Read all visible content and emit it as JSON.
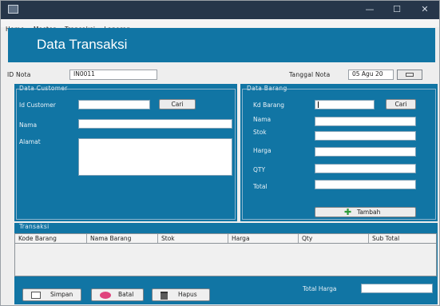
{
  "window": {
    "controls": {
      "minimize": "—",
      "maximize": "☐",
      "close": "✕"
    }
  },
  "menu": [
    "Home",
    "Master",
    "Transaksi",
    "Laporan"
  ],
  "header": {
    "title": "Data Transaksi"
  },
  "id_row": {
    "id_label": "ID Nota",
    "id_value": "IN0011",
    "date_label": "Tanggal Nota",
    "date_value": "05 Agu 20"
  },
  "customer": {
    "legend": "Data Customer",
    "id_label": "Id Customer",
    "search_label": "Cari",
    "name_label": "Nama",
    "address_label": "Alamat"
  },
  "barang": {
    "legend": "Data Barang",
    "kd_label": "Kd Barang",
    "search_label": "Cari",
    "name_label": "Nama",
    "stok_label": "Stok",
    "harga_label": "Harga",
    "qty_label": "QTY",
    "total_label": "Total",
    "add_label": "Tambah"
  },
  "transaksi": {
    "legend": "Transaksi",
    "columns": [
      "Kode Barang",
      "Nama Barang",
      "Stok",
      "Harga",
      "Qty",
      "Sub Total"
    ]
  },
  "footer": {
    "save_label": "Simpan",
    "cancel_label": "Batal",
    "delete_label": "Hapus",
    "total_label": "Total Harga"
  },
  "colors": {
    "accent": "#1175a4",
    "titlebar": "#26364a"
  }
}
